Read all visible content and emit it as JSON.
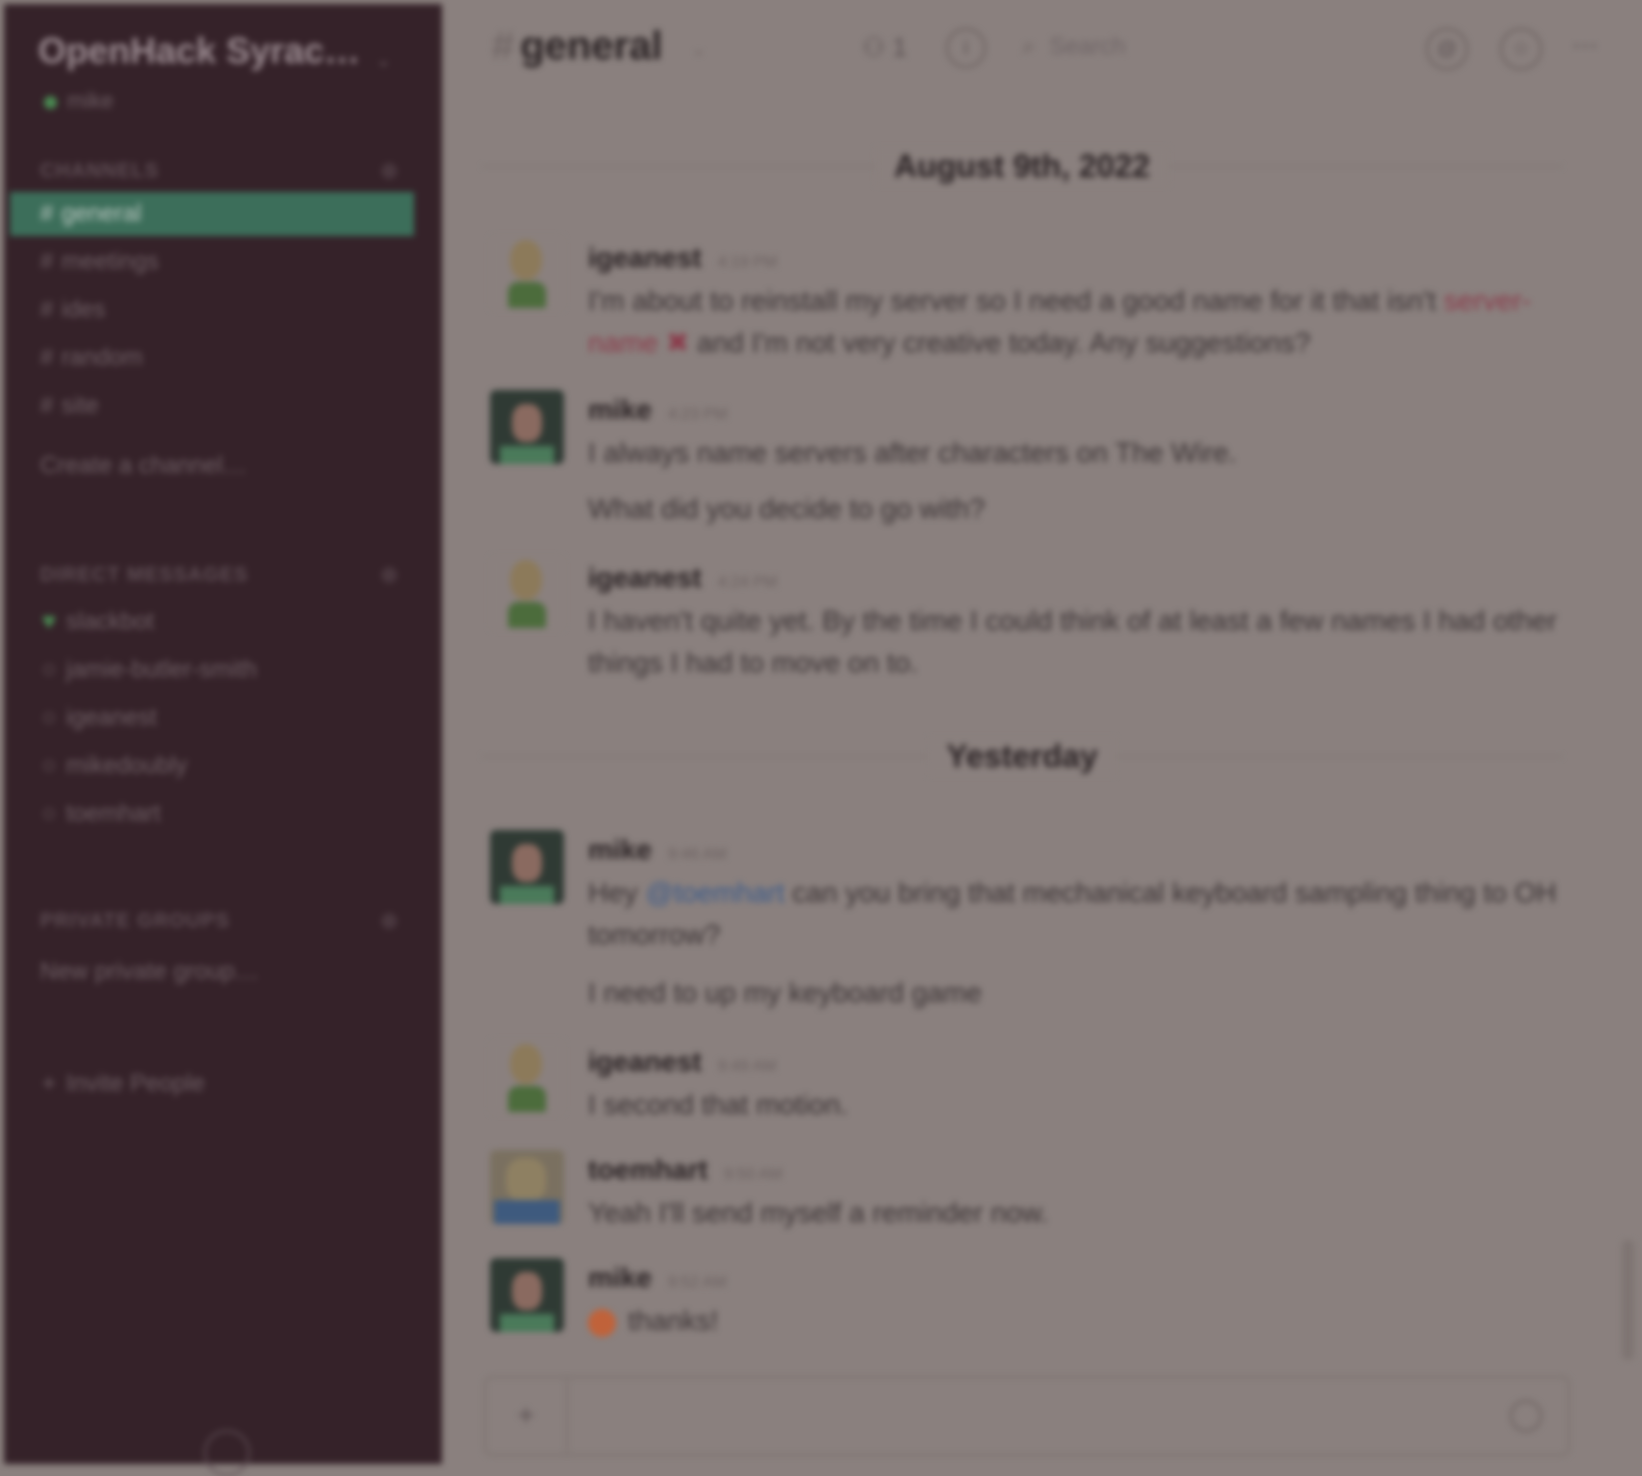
{
  "sidebar": {
    "team_name": "OpenHack Syrac…",
    "user": "mike",
    "channels_header": "CHANNELS",
    "channels": [
      {
        "label": "general",
        "active": true
      },
      {
        "label": "meetings"
      },
      {
        "label": "ides"
      },
      {
        "label": "random"
      },
      {
        "label": "site"
      }
    ],
    "create_channel": "Create a channel…",
    "dm_header": "DIRECT MESSAGES",
    "dms": [
      "slackbot",
      "jamie-butler-smith",
      "igeanest",
      "mikedoubly",
      "toemhart"
    ],
    "groups_header": "PRIVATE GROUPS",
    "new_group": "New private group…",
    "invite": "Invite People"
  },
  "header": {
    "channel": "general",
    "members": "1",
    "search_placeholder": "Search"
  },
  "messages": {
    "day1": "August 9th, 2022",
    "day2": "Yesterday",
    "m1": {
      "author": "igeanest",
      "time": "4:19 PM",
      "pre": "I'm about to reinstall my server so I need a good name for it that isn't ",
      "highlight": "server-name ✖",
      "post": " and I'm not very creative today. Any suggestions?"
    },
    "m2": {
      "author": "mike",
      "time": "4:23 PM",
      "line1": "I always name servers after characters on The Wire.",
      "line2": "What did you decide to go with?"
    },
    "m3": {
      "author": "igeanest",
      "time": "4:24 PM",
      "text": "I haven't quite yet. By the time I could think of at least a few names I had other things I had to move on to."
    },
    "m4": {
      "author": "mike",
      "time": "9:46 AM",
      "pre": "Hey ",
      "mention": "@toemhart",
      "post": " can you bring that mechanical keyboard sampling thing to OH tomorrow?",
      "line2": "I need to up my keyboard game"
    },
    "m5": {
      "author": "igeanest",
      "time": "9:49 AM",
      "text": "I second that motion."
    },
    "m6": {
      "author": "toemhart",
      "time": "9:50 AM",
      "text": "Yeah I'll send myself a reminder now."
    },
    "m7": {
      "author": "mike",
      "time": "9:52 AM",
      "text": "thanks!"
    }
  }
}
